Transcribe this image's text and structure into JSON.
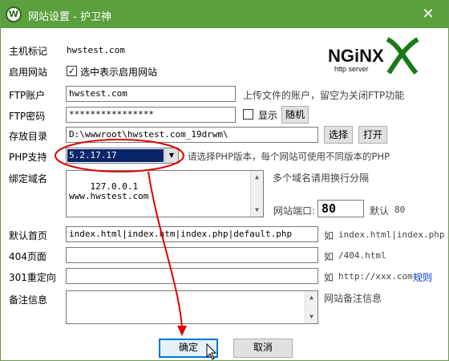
{
  "window": {
    "title": "网站设置 - 护卫神"
  },
  "logo": {
    "text": "NGiNX",
    "subtext": "http server"
  },
  "fields": {
    "host": {
      "label": "主机标记",
      "value": "hwstest.com"
    },
    "enable": {
      "label": "启用网站",
      "checkbox_label": "选中表示启用网站",
      "checked": true
    },
    "ftp_user": {
      "label": "FTP账户",
      "value": "hwstest.com",
      "hint": "上传文件的账户，留空为关闭FTP功能"
    },
    "ftp_pass": {
      "label": "FTP密码",
      "value": "****************",
      "show_label": "显示",
      "random_button": "随机"
    },
    "dir": {
      "label": "存放目录",
      "value": "D:\\wwwroot\\hwstest.com_19drwm\\",
      "select_button": "选择",
      "open_button": "打开"
    },
    "php": {
      "label": "PHP支持",
      "value": "5.2.17.17",
      "hint": "请选择PHP版本，每个网站可使用不同版本的PHP"
    },
    "domain": {
      "label": "绑定域名",
      "value": "127.0.0.1\nwww.hwstest.com",
      "hint": "多个域名请用换行分隔"
    },
    "port": {
      "label": "网站端口:",
      "value": "80",
      "default_label": "默认",
      "default_value": "80"
    },
    "index": {
      "label": "默认首页",
      "value": "index.html|index.htm|index.php|default.php",
      "hint_prefix": "如",
      "hint_value": "index.html|index.php"
    },
    "page404": {
      "label": "404页面",
      "value": "",
      "hint_prefix": "如",
      "hint_value": "/404.html"
    },
    "redirect": {
      "label": "301重定向",
      "value": "",
      "hint_prefix": "如",
      "hint_value": "http://xxx.com",
      "rule_link": "规则"
    },
    "note": {
      "label": "备注信息",
      "value": "",
      "hint": "网站备注信息"
    }
  },
  "buttons": {
    "ok": "确定",
    "cancel": "取消"
  },
  "colors": {
    "titlebar": "#5aa13d",
    "annotation": "#e00000",
    "selection": "#0a246a",
    "link": "#0033cc"
  },
  "icons": {
    "app": "shield-w-icon",
    "close": "close-icon",
    "cursor": "mouse-pointer-icon"
  }
}
